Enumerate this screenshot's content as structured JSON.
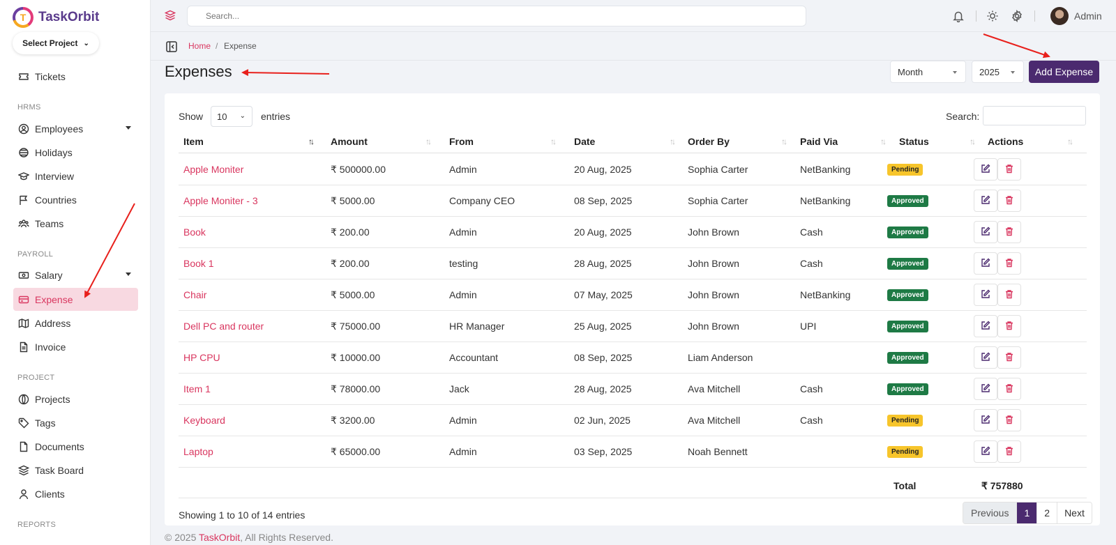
{
  "app": {
    "name": "TaskOrbit",
    "logo_letter": "T"
  },
  "sidebar": {
    "project_select": "Select Project",
    "items_top": [
      {
        "label": "Tickets",
        "icon": "ticket-icon"
      }
    ],
    "hrms_label": "HRMS",
    "hrms_items": [
      {
        "label": "Employees",
        "icon": "user-circle-icon"
      },
      {
        "label": "Holidays",
        "icon": "holiday-icon"
      },
      {
        "label": "Interview",
        "icon": "graduation-cap-icon"
      },
      {
        "label": "Countries",
        "icon": "flag-icon"
      },
      {
        "label": "Teams",
        "icon": "team-icon"
      }
    ],
    "payroll_label": "PAYROLL",
    "payroll_items": [
      {
        "label": "Salary",
        "icon": "money-icon"
      },
      {
        "label": "Expense",
        "icon": "wallet-icon"
      },
      {
        "label": "Address",
        "icon": "map-icon"
      },
      {
        "label": "Invoice",
        "icon": "invoice-icon"
      }
    ],
    "project_label": "PROJECT",
    "project_items": [
      {
        "label": "Projects",
        "icon": "globe-icon"
      },
      {
        "label": "Tags",
        "icon": "tag-icon"
      },
      {
        "label": "Documents",
        "icon": "document-icon"
      },
      {
        "label": "Task Board",
        "icon": "stack-icon"
      },
      {
        "label": "Clients",
        "icon": "user-icon"
      }
    ],
    "reports_label": "REPORTS"
  },
  "topbar": {
    "search_placeholder": "Search...",
    "user_name": "Admin"
  },
  "breadcrumb": {
    "home": "Home",
    "separator": "/",
    "current": "Expense"
  },
  "page": {
    "title": "Expenses",
    "filter_period": "Month",
    "filter_year": "2025",
    "add_button": "Add Expense"
  },
  "table": {
    "show_label": "Show",
    "page_length": "10",
    "entries_label": "entries",
    "search_label": "Search:",
    "columns": [
      "Item",
      "Amount",
      "From",
      "Date",
      "Order By",
      "Paid Via",
      "Status",
      "Actions"
    ],
    "rows": [
      {
        "item": "Apple Moniter",
        "amount": "₹ 500000.00",
        "from": "Admin",
        "date": "20 Aug, 2025",
        "order_by": "Sophia Carter",
        "paid_via": "NetBanking",
        "status": "Pending"
      },
      {
        "item": "Apple Moniter - 3",
        "amount": "₹ 5000.00",
        "from": "Company CEO",
        "date": "08 Sep, 2025",
        "order_by": "Sophia Carter",
        "paid_via": "NetBanking",
        "status": "Approved"
      },
      {
        "item": "Book",
        "amount": "₹ 200.00",
        "from": "Admin",
        "date": "20 Aug, 2025",
        "order_by": "John Brown",
        "paid_via": "Cash",
        "status": "Approved"
      },
      {
        "item": "Book 1",
        "amount": "₹ 200.00",
        "from": "testing",
        "date": "28 Aug, 2025",
        "order_by": "John Brown",
        "paid_via": "Cash",
        "status": "Approved"
      },
      {
        "item": "Chair",
        "amount": "₹ 5000.00",
        "from": "Admin",
        "date": "07 May, 2025",
        "order_by": "John Brown",
        "paid_via": "NetBanking",
        "status": "Approved"
      },
      {
        "item": "Dell PC and router",
        "amount": "₹ 75000.00",
        "from": "HR Manager",
        "date": "25 Aug, 2025",
        "order_by": "John Brown",
        "paid_via": "UPI",
        "status": "Approved"
      },
      {
        "item": "HP CPU",
        "amount": "₹ 10000.00",
        "from": "Accountant",
        "date": "08 Sep, 2025",
        "order_by": "Liam Anderson",
        "paid_via": "",
        "status": "Approved"
      },
      {
        "item": "Item 1",
        "amount": "₹ 78000.00",
        "from": "Jack",
        "date": "28 Aug, 2025",
        "order_by": "Ava Mitchell",
        "paid_via": "Cash",
        "status": "Approved"
      },
      {
        "item": "Keyboard",
        "amount": "₹ 3200.00",
        "from": "Admin",
        "date": "02 Jun, 2025",
        "order_by": "Ava Mitchell",
        "paid_via": "Cash",
        "status": "Pending"
      },
      {
        "item": "Laptop",
        "amount": "₹ 65000.00",
        "from": "Admin",
        "date": "03 Sep, 2025",
        "order_by": "Noah Bennett",
        "paid_via": "",
        "status": "Pending"
      }
    ],
    "total_label": "Total",
    "total_value": "₹ 757880",
    "info": "Showing 1 to 10 of 14 entries",
    "pagination": {
      "prev": "Previous",
      "pages": [
        "1",
        "2"
      ],
      "next": "Next"
    }
  },
  "footer": {
    "prefix": "© 2025 ",
    "brand": "TaskOrbit",
    "suffix": ", All Rights Reserved."
  },
  "colors": {
    "accent": "#d9365f",
    "primary": "#4b2a6f",
    "pending": "#f7c52b",
    "approved": "#1e7a45"
  }
}
